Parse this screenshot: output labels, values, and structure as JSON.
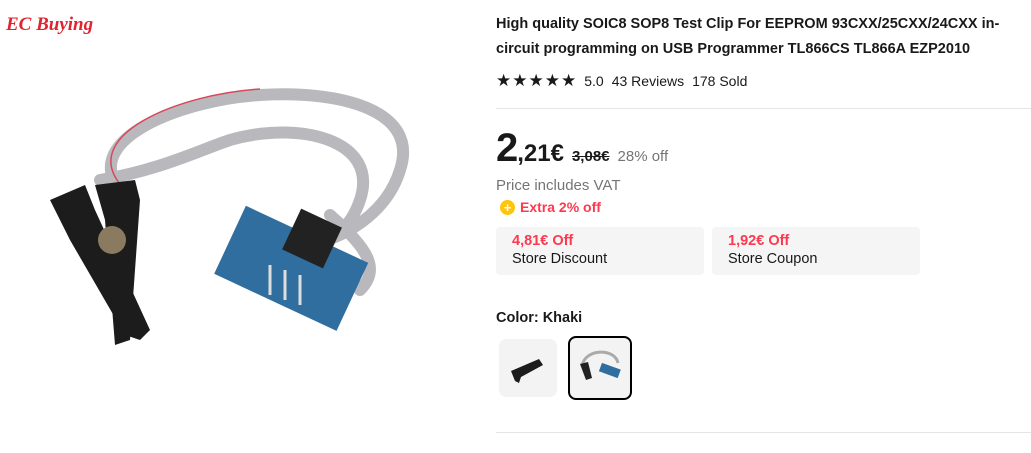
{
  "gallery": {
    "brand": "EC Buying"
  },
  "product": {
    "title": "High quality SOIC8 SOP8 Test Clip For EEPROM 93CXX/25CXX/24CXX in-circuit programming on USB Programmer TL866CS TL866A EZP2010",
    "rating": "5.0",
    "reviews": "43 Reviews",
    "sold": "178 Sold",
    "stars": 5,
    "price_int": "2",
    "price_dec": ",21€",
    "original_price": "3,08€",
    "discount": "28% off",
    "vat": "Price includes VAT",
    "extra": "Extra 2% off",
    "coupons": [
      {
        "amount": "4,81€ Off",
        "label": "Store Discount"
      },
      {
        "amount": "1,92€ Off",
        "label": "Store Coupon"
      }
    ],
    "color_label": "Color: Khaki",
    "variants": [
      {
        "name": "clip",
        "selected": false
      },
      {
        "name": "clip-with-cable",
        "selected": true
      }
    ]
  },
  "colors": {
    "accent": "#fd384f",
    "coin": "#ffc40c"
  }
}
